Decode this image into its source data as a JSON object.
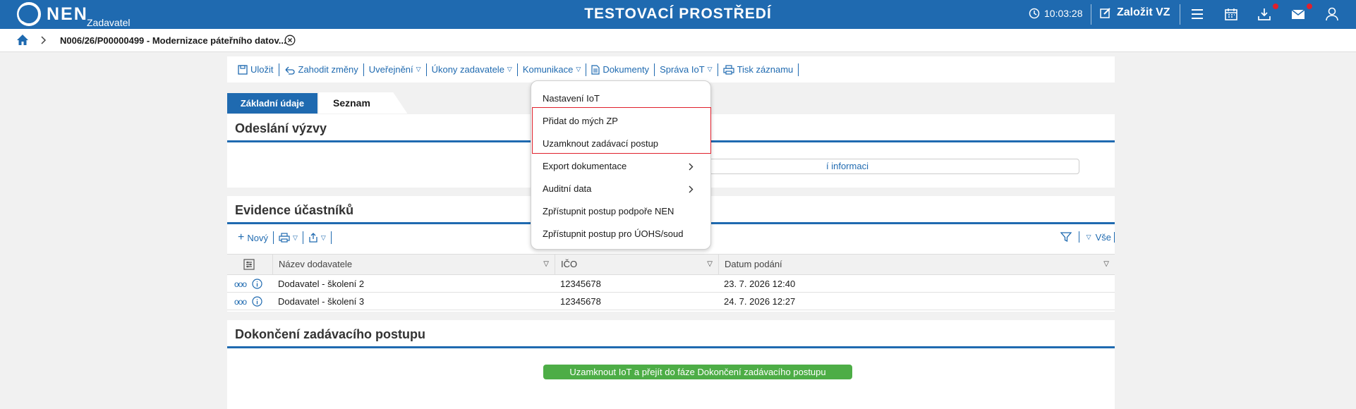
{
  "header": {
    "logo_text": "NEN",
    "logo_subtitle": "Zadavatel",
    "environment_title": "TESTOVACÍ PROSTŘEDÍ",
    "clock": "10:03:28",
    "new_tender_label": "Založit VZ",
    "accent_color": "#1f6ab0"
  },
  "breadcrumb": {
    "current": "N006/26/P00000499 - Modernizace páteřního datov..."
  },
  "toolbar": {
    "save": "Uložit",
    "discard": "Zahodit změny",
    "publish": "Uveřejnění",
    "actions": "Úkony zadavatele",
    "communication": "Komunikace",
    "documents": "Dokumenty",
    "manage_iot": "Správa IoT",
    "print": "Tisk záznamu"
  },
  "tabs": {
    "basic": "Základní údaje",
    "participants": "Seznam účastníků"
  },
  "section_send": {
    "title": "Odeslání výzvy",
    "field_text": "í informaci"
  },
  "section_evidence": {
    "title": "Evidence účastníků",
    "new_label": "Nový",
    "all_label": "Vše",
    "columns": [
      "Název dodavatele",
      "IČO",
      "Datum podání"
    ],
    "rows": [
      {
        "name": "Dodavatel - školení 2",
        "ico": "12345678",
        "date": "23. 7. 2026 12:40"
      },
      {
        "name": "Dodavatel - školení 3",
        "ico": "12345678",
        "date": "24. 7. 2026 12:27"
      }
    ]
  },
  "section_finish": {
    "title": "Dokončení zadávacího postupu",
    "button": "Uzamknout IoT a přejít do fáze Dokončení zadávacího postupu",
    "button_color": "#4dad46"
  },
  "dropdown": {
    "items": [
      "Nastavení IoT",
      "Přidat do mých ZP",
      "Uzamknout zadávací postup",
      "Export dokumentace",
      "Auditní data",
      "Zpřístupnit postup podpoře NEN",
      "Zpřístupnit postup pro ÚOHS/soud"
    ],
    "highlight_color": "#e0202c"
  }
}
